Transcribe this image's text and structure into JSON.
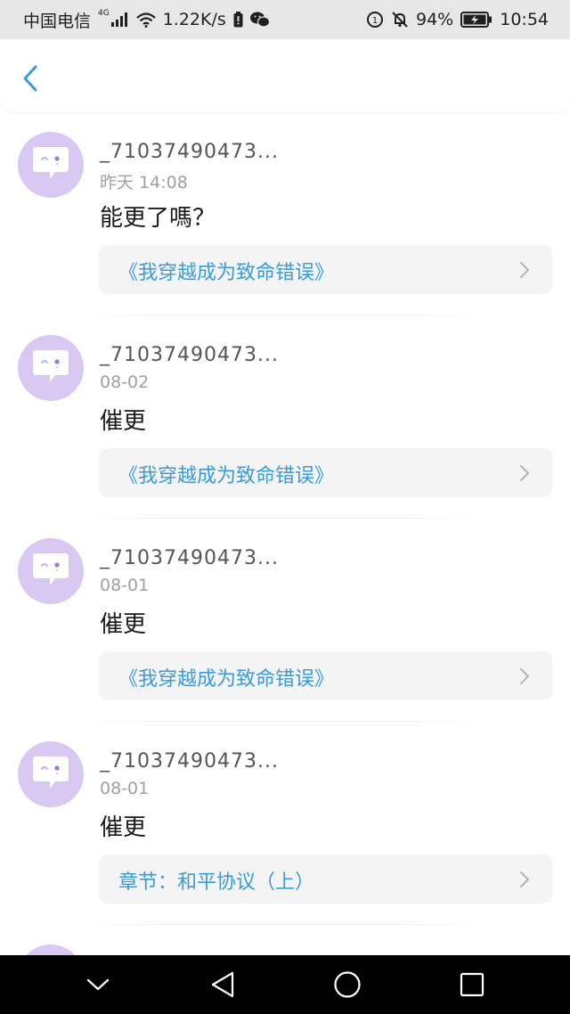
{
  "status_bar": {
    "carrier": "中国电信",
    "network_tag": "4G",
    "speed": "1.22K/s",
    "battery": "94%",
    "time": "10:54"
  },
  "colors": {
    "accent": "#3a9bdc",
    "avatar_bg": "#d8c8f2",
    "card_bg": "#f4f4f4"
  },
  "comments": [
    {
      "username": "_71037490473...",
      "date": "昨天 14:08",
      "message": "能更了嗎？",
      "link": "《我穿越成为致命错误》"
    },
    {
      "username": "_71037490473...",
      "date": "08-02",
      "message": "催更",
      "link": "《我穿越成为致命错误》"
    },
    {
      "username": "_71037490473...",
      "date": "08-01",
      "message": "催更",
      "link": "《我穿越成为致命错误》"
    },
    {
      "username": "_71037490473...",
      "date": "08-01",
      "message": "催更",
      "link": "章节：和平协议（上）"
    }
  ],
  "icons": {
    "back": "chevron-left-icon",
    "avatar": "chat-bubble-face-icon",
    "card_arrow": "chevron-right-icon",
    "nav": [
      "chevron-down-icon",
      "back-triangle-icon",
      "home-circle-icon",
      "recents-square-icon"
    ]
  }
}
